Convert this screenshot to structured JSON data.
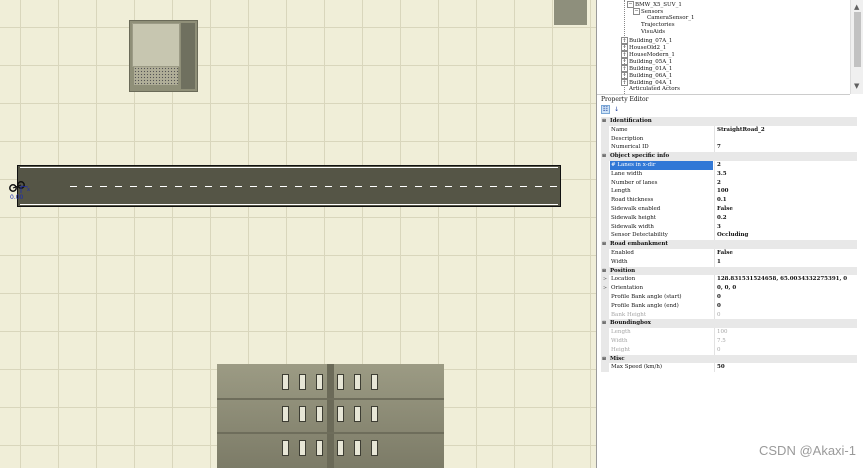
{
  "tree": {
    "items": [
      {
        "label": "BMW_X5_SUV_1",
        "indent": 2,
        "expander": "−"
      },
      {
        "label": "Sensors",
        "indent": 3,
        "expander": "−"
      },
      {
        "label": "CameraSensor_1",
        "indent": 4,
        "expander": ""
      },
      {
        "label": "Trajectories",
        "indent": 3,
        "expander": ""
      },
      {
        "label": "VisuAids",
        "indent": 3,
        "expander": ""
      },
      {
        "label": "Building_07A_1",
        "indent": 1,
        "expander": "+"
      },
      {
        "label": "HouseOld2_1",
        "indent": 1,
        "expander": "+"
      },
      {
        "label": "HouseModern_1",
        "indent": 1,
        "expander": "+"
      },
      {
        "label": "Building_05A_1",
        "indent": 1,
        "expander": "+"
      },
      {
        "label": "Building_01A_1",
        "indent": 1,
        "expander": "+"
      },
      {
        "label": "Building_06A_1",
        "indent": 1,
        "expander": "+"
      },
      {
        "label": "Building_04A_1",
        "indent": 1,
        "expander": "+"
      },
      {
        "label": "Articulated Actors",
        "indent": 1,
        "expander": ""
      }
    ]
  },
  "property_editor": {
    "title": "Property Editor",
    "sections": [
      {
        "title": "Identification",
        "props": [
          {
            "name": "Name",
            "value": "StraightRoad_2"
          },
          {
            "name": "Description",
            "value": ""
          },
          {
            "name": "Numerical ID",
            "value": "7"
          }
        ]
      },
      {
        "title": "Object specific info",
        "props": [
          {
            "name": "# Lanes in x-dir",
            "value": "2",
            "selected": true
          },
          {
            "name": "Lane width",
            "value": "3.5"
          },
          {
            "name": "Number of lanes",
            "value": "2"
          },
          {
            "name": "Length",
            "value": "100"
          },
          {
            "name": "Road thickness",
            "value": "0.1"
          },
          {
            "name": "Sidewalk enabled",
            "value": "False"
          },
          {
            "name": "Sidewalk height",
            "value": "0.2"
          },
          {
            "name": "Sidewalk width",
            "value": "3"
          },
          {
            "name": "Sensor Detectability",
            "value": "Occluding"
          }
        ]
      },
      {
        "title": "Road embankment",
        "props": [
          {
            "name": "Enabled",
            "value": "False"
          },
          {
            "name": "Width",
            "value": "1"
          }
        ]
      },
      {
        "title": "Position",
        "props": [
          {
            "name": "Location",
            "value": "128.831531524658, 65.0034332275391, 0",
            "expand": ">"
          },
          {
            "name": "Orientation",
            "value": "0, 0, 0",
            "expand": ">"
          },
          {
            "name": "Profile Bank angle (start)",
            "value": "0"
          },
          {
            "name": "Profile Bank angle (end)",
            "value": "0"
          },
          {
            "name": "Bank Height",
            "value": "0",
            "disabled": true
          }
        ]
      },
      {
        "title": "Boundingbox",
        "props": [
          {
            "name": "Length",
            "value": "100",
            "disabled": true
          },
          {
            "name": "Width",
            "value": "7.5",
            "disabled": true
          },
          {
            "name": "Height",
            "value": "0",
            "disabled": true
          }
        ]
      },
      {
        "title": "Misc",
        "props": [
          {
            "name": "Max Speed (km/h)",
            "value": "50"
          }
        ]
      }
    ]
  },
  "viewport": {
    "gizmo_label": "0.00"
  },
  "watermark": "CSDN @Akaxi-1",
  "colors": {
    "selection": "#3178d6",
    "viewport_bg": "#f0eed8",
    "road": "#555546"
  },
  "icons": [
    "categorized-icon",
    "sort-alpha-icon"
  ]
}
